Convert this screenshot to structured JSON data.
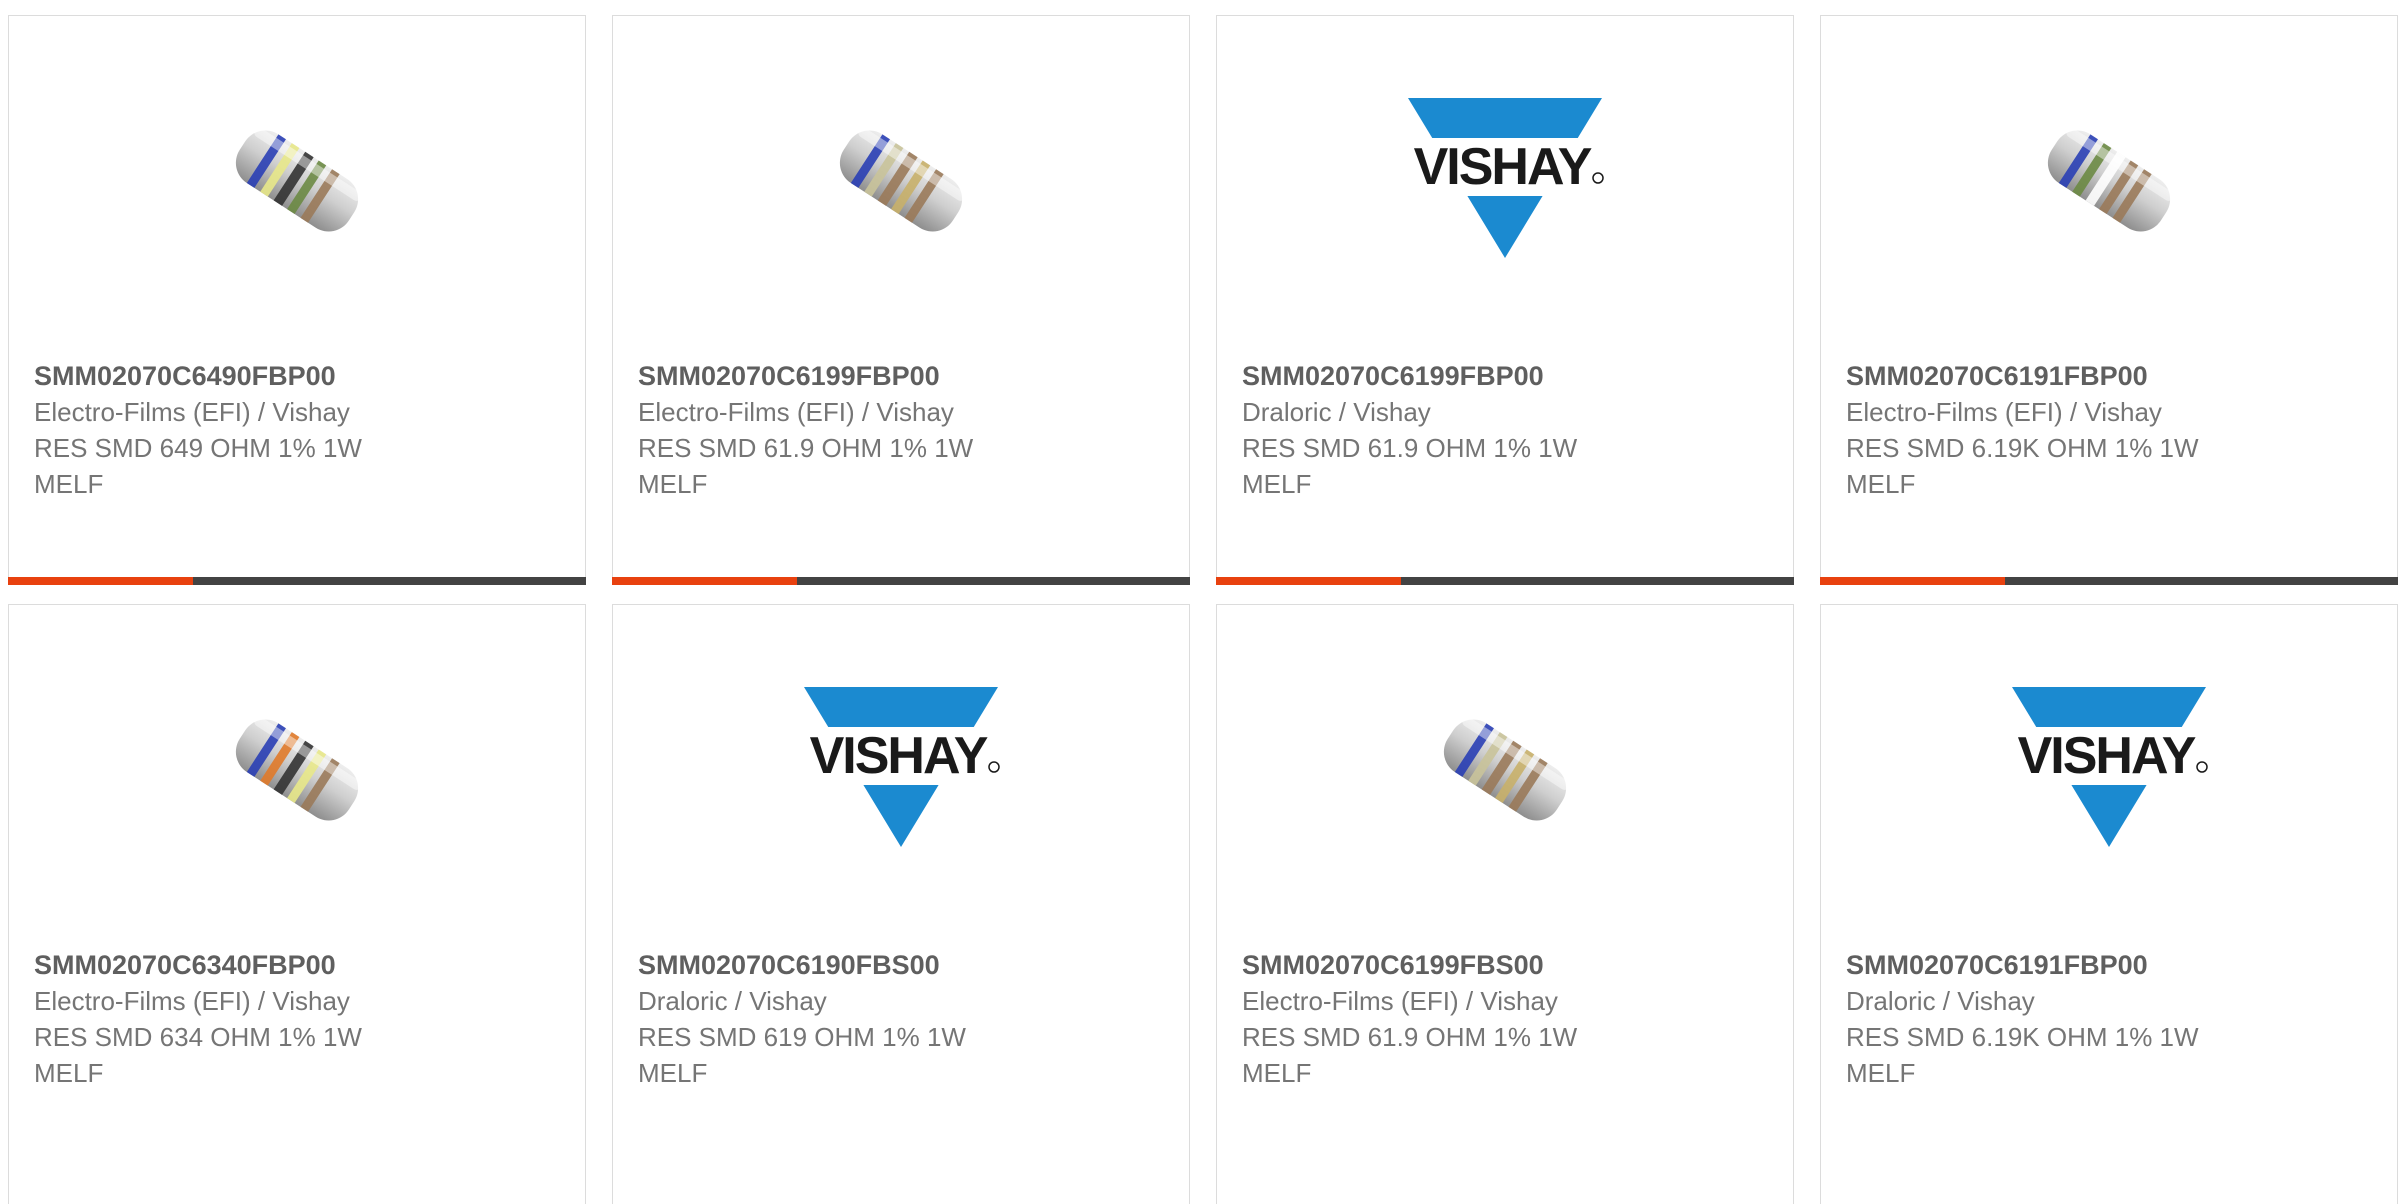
{
  "colors": {
    "accent": "#e8410f",
    "track": "#434343",
    "vishay_blue": "#1b8ad0"
  },
  "products": [
    {
      "part": "SMM02070C6490FBP00",
      "manufacturer": "Electro-Films (EFI) / Vishay",
      "description": "RES SMD 649 OHM 1% 1W",
      "package": "MELF",
      "image": "resistor",
      "bands": [
        "#2a3fb5",
        "#e8e88a",
        "#333333",
        "#6b8a44",
        "#9a7a5a"
      ],
      "progress": 0.32
    },
    {
      "part": "SMM02070C6199FBP00",
      "manufacturer": "Electro-Films (EFI) / Vishay",
      "description": "RES SMD 61.9 OHM 1% 1W",
      "package": "MELF",
      "image": "resistor",
      "bands": [
        "#2a3fb5",
        "#c9c39a",
        "#9a7a5a",
        "#c8b06a",
        "#9a7a5a"
      ],
      "progress": 0.32
    },
    {
      "part": "SMM02070C6199FBP00",
      "manufacturer": "Draloric / Vishay",
      "description": "RES SMD 61.9 OHM 1% 1W",
      "package": "MELF",
      "image": "vishay-logo",
      "logo_text": "VISHAY",
      "progress": 0.32
    },
    {
      "part": "SMM02070C6191FBP00",
      "manufacturer": "Electro-Films (EFI) / Vishay",
      "description": "RES SMD 6.19K OHM 1% 1W",
      "package": "MELF",
      "image": "resistor",
      "bands": [
        "#2a3fb5",
        "#6b8a44",
        "#ffffff",
        "#9a7a5a",
        "#9a7a5a"
      ],
      "progress": 0.32
    },
    {
      "part": "SMM02070C6340FBP00",
      "manufacturer": "Electro-Films (EFI) / Vishay",
      "description": "RES SMD 634 OHM 1% 1W",
      "package": "MELF",
      "image": "resistor",
      "bands": [
        "#2a3fb5",
        "#e07a2a",
        "#333333",
        "#e8e88a",
        "#9a7a5a"
      ],
      "progress": null
    },
    {
      "part": "SMM02070C6190FBS00",
      "manufacturer": "Draloric / Vishay",
      "description": "RES SMD 619 OHM 1% 1W",
      "package": "MELF",
      "image": "vishay-logo",
      "logo_text": "VISHAY",
      "progress": null
    },
    {
      "part": "SMM02070C6199FBS00",
      "manufacturer": "Electro-Films (EFI) / Vishay",
      "description": "RES SMD 61.9 OHM 1% 1W",
      "package": "MELF",
      "image": "resistor",
      "bands": [
        "#2a3fb5",
        "#c9c39a",
        "#9a7a5a",
        "#c8b06a",
        "#9a7a5a"
      ],
      "progress": null
    },
    {
      "part": "SMM02070C6191FBP00",
      "manufacturer": "Draloric / Vishay",
      "description": "RES SMD 6.19K OHM 1% 1W",
      "package": "MELF",
      "image": "vishay-logo",
      "logo_text": "VISHAY",
      "progress": null
    }
  ]
}
